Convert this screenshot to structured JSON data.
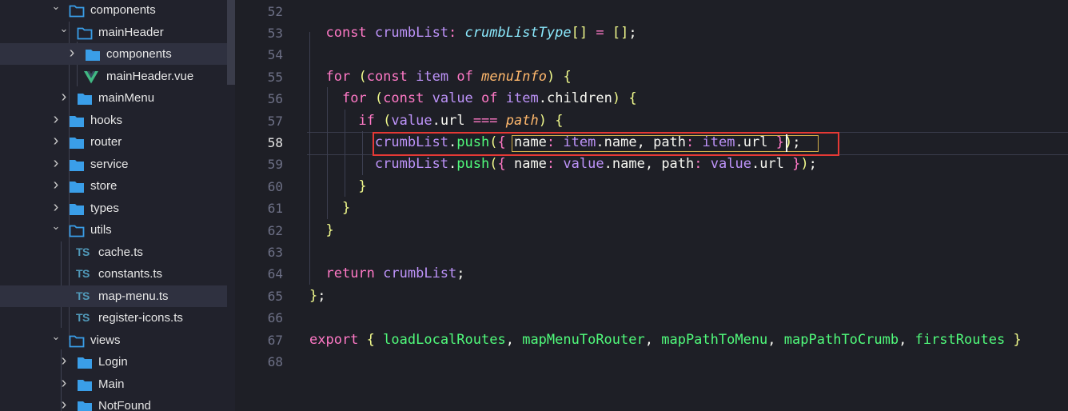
{
  "explorer": {
    "items": [
      {
        "label": "components",
        "expanded": true,
        "type": "folder"
      },
      {
        "label": "mainHeader",
        "expanded": true,
        "type": "folder"
      },
      {
        "label": "components",
        "expanded": false,
        "type": "folder"
      },
      {
        "label": "mainHeader.vue",
        "type": "vue-file",
        "icon_text": "V"
      },
      {
        "label": "mainMenu",
        "expanded": false,
        "type": "folder"
      },
      {
        "label": "hooks",
        "expanded": false,
        "type": "folder"
      },
      {
        "label": "router",
        "expanded": false,
        "type": "folder"
      },
      {
        "label": "service",
        "expanded": false,
        "type": "folder"
      },
      {
        "label": "store",
        "expanded": false,
        "type": "folder"
      },
      {
        "label": "types",
        "expanded": false,
        "type": "folder"
      },
      {
        "label": "utils",
        "expanded": true,
        "type": "folder"
      },
      {
        "label": "cache.ts",
        "type": "ts-file",
        "icon_text": "TS"
      },
      {
        "label": "constants.ts",
        "type": "ts-file",
        "icon_text": "TS"
      },
      {
        "label": "map-menu.ts",
        "type": "ts-file",
        "icon_text": "TS"
      },
      {
        "label": "register-icons.ts",
        "type": "ts-file",
        "icon_text": "TS"
      },
      {
        "label": "views",
        "expanded": true,
        "type": "folder"
      },
      {
        "label": "Login",
        "expanded": false,
        "type": "folder"
      },
      {
        "label": "Main",
        "expanded": false,
        "type": "folder"
      },
      {
        "label": "NotFound",
        "expanded": false,
        "type": "folder"
      }
    ]
  },
  "editor": {
    "active_line": "58",
    "lines": [
      {
        "n": "52",
        "code": ""
      },
      {
        "n": "53",
        "code": "  const crumbList: crumbListType[] = [];"
      },
      {
        "n": "54",
        "code": ""
      },
      {
        "n": "55",
        "code": "  for (const item of menuInfo) {"
      },
      {
        "n": "56",
        "code": "    for (const value of item.children) {"
      },
      {
        "n": "57",
        "code": "      if (value.url === path) {"
      },
      {
        "n": "58",
        "code": "        crumbList.push({ name: item.name, path: item.url });"
      },
      {
        "n": "59",
        "code": "        crumbList.push({ name: value.name, path: value.url });"
      },
      {
        "n": "60",
        "code": "      }"
      },
      {
        "n": "61",
        "code": "    }"
      },
      {
        "n": "62",
        "code": "  }"
      },
      {
        "n": "63",
        "code": ""
      },
      {
        "n": "64",
        "code": "  return crumbList;"
      },
      {
        "n": "65",
        "code": "};"
      },
      {
        "n": "66",
        "code": ""
      },
      {
        "n": "67",
        "code": "export { loadLocalRoutes, mapMenuToRouter, mapPathToMenu, mapPathToCrumb, firstRoutes }"
      },
      {
        "n": "68",
        "code": ""
      }
    ]
  },
  "colors": {
    "background": "#1e1f26",
    "sidebar": "#21222c",
    "keyword": "#ff79c6",
    "variable": "#bd93f9",
    "function": "#50fa7b",
    "type": "#8be9fd",
    "parameter": "#ffb86c",
    "highlight_box": "#e53935",
    "folder_icon": "#3a9ee8",
    "vue_icon": "#41b883",
    "ts_icon": "#519aba"
  }
}
